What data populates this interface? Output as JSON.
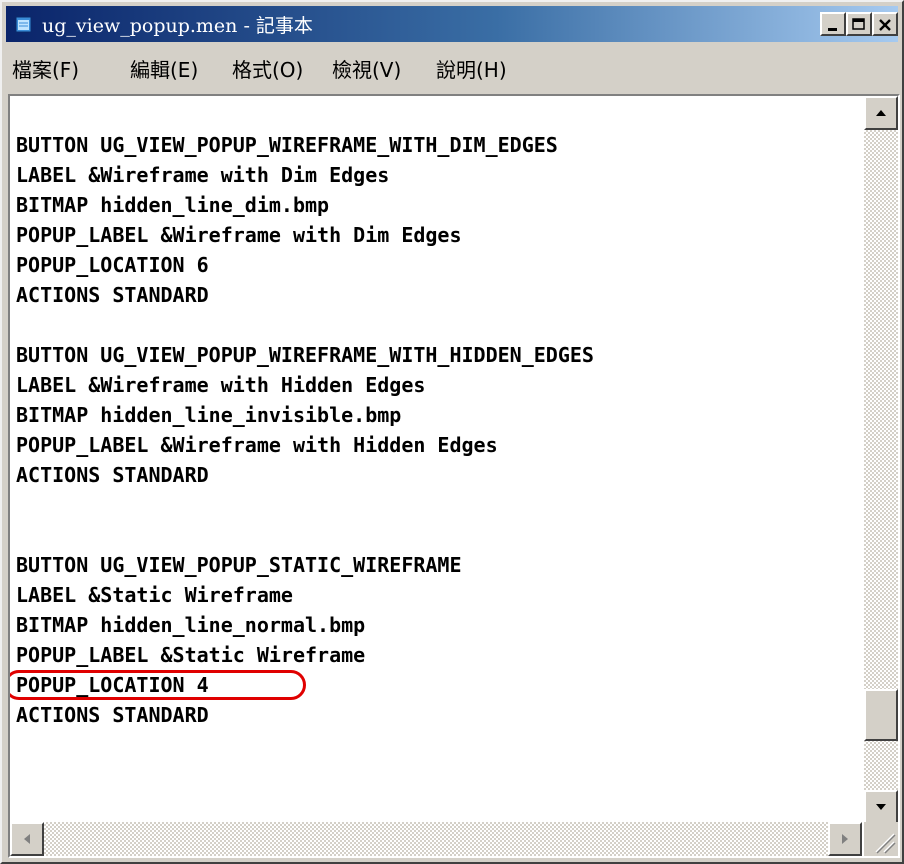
{
  "window": {
    "title": "ug_view_popup.men - 記事本",
    "controls": [
      "minimize",
      "maximize",
      "close"
    ]
  },
  "menu": [
    {
      "label": "檔案(F)"
    },
    {
      "label": "編輯(E)"
    },
    {
      "label": "格式(O)"
    },
    {
      "label": "檢視(V)"
    },
    {
      "label": "說明(H)"
    }
  ],
  "document": {
    "lines": [
      "",
      "BUTTON UG_VIEW_POPUP_WIREFRAME_WITH_DIM_EDGES",
      "LABEL &Wireframe with Dim Edges",
      "BITMAP hidden_line_dim.bmp",
      "POPUP_LABEL &Wireframe with Dim Edges",
      "POPUP_LOCATION 6",
      "ACTIONS STANDARD",
      "",
      "BUTTON UG_VIEW_POPUP_WIREFRAME_WITH_HIDDEN_EDGES",
      "LABEL &Wireframe with Hidden Edges",
      "BITMAP hidden_line_invisible.bmp",
      "POPUP_LABEL &Wireframe with Hidden Edges",
      "ACTIONS STANDARD",
      "",
      "",
      "BUTTON UG_VIEW_POPUP_STATIC_WIREFRAME",
      "LABEL &Static Wireframe",
      "BITMAP hidden_line_normal.bmp",
      "POPUP_LABEL &Static Wireframe",
      "POPUP_LOCATION 4",
      "ACTIONS STANDARD"
    ],
    "highlighted_line_index": 19
  },
  "colors": {
    "title_start": "#0a246a",
    "title_end": "#a6caf0",
    "highlight": "#e00000",
    "chrome": "#d4d0c8"
  },
  "icons": {
    "app": "notepad-icon",
    "scroll_up": "arrow-up-icon",
    "scroll_down": "arrow-down-icon",
    "scroll_left": "arrow-left-icon",
    "scroll_right": "arrow-right-icon"
  },
  "scroll": {
    "vertical_position": 0.92
  }
}
